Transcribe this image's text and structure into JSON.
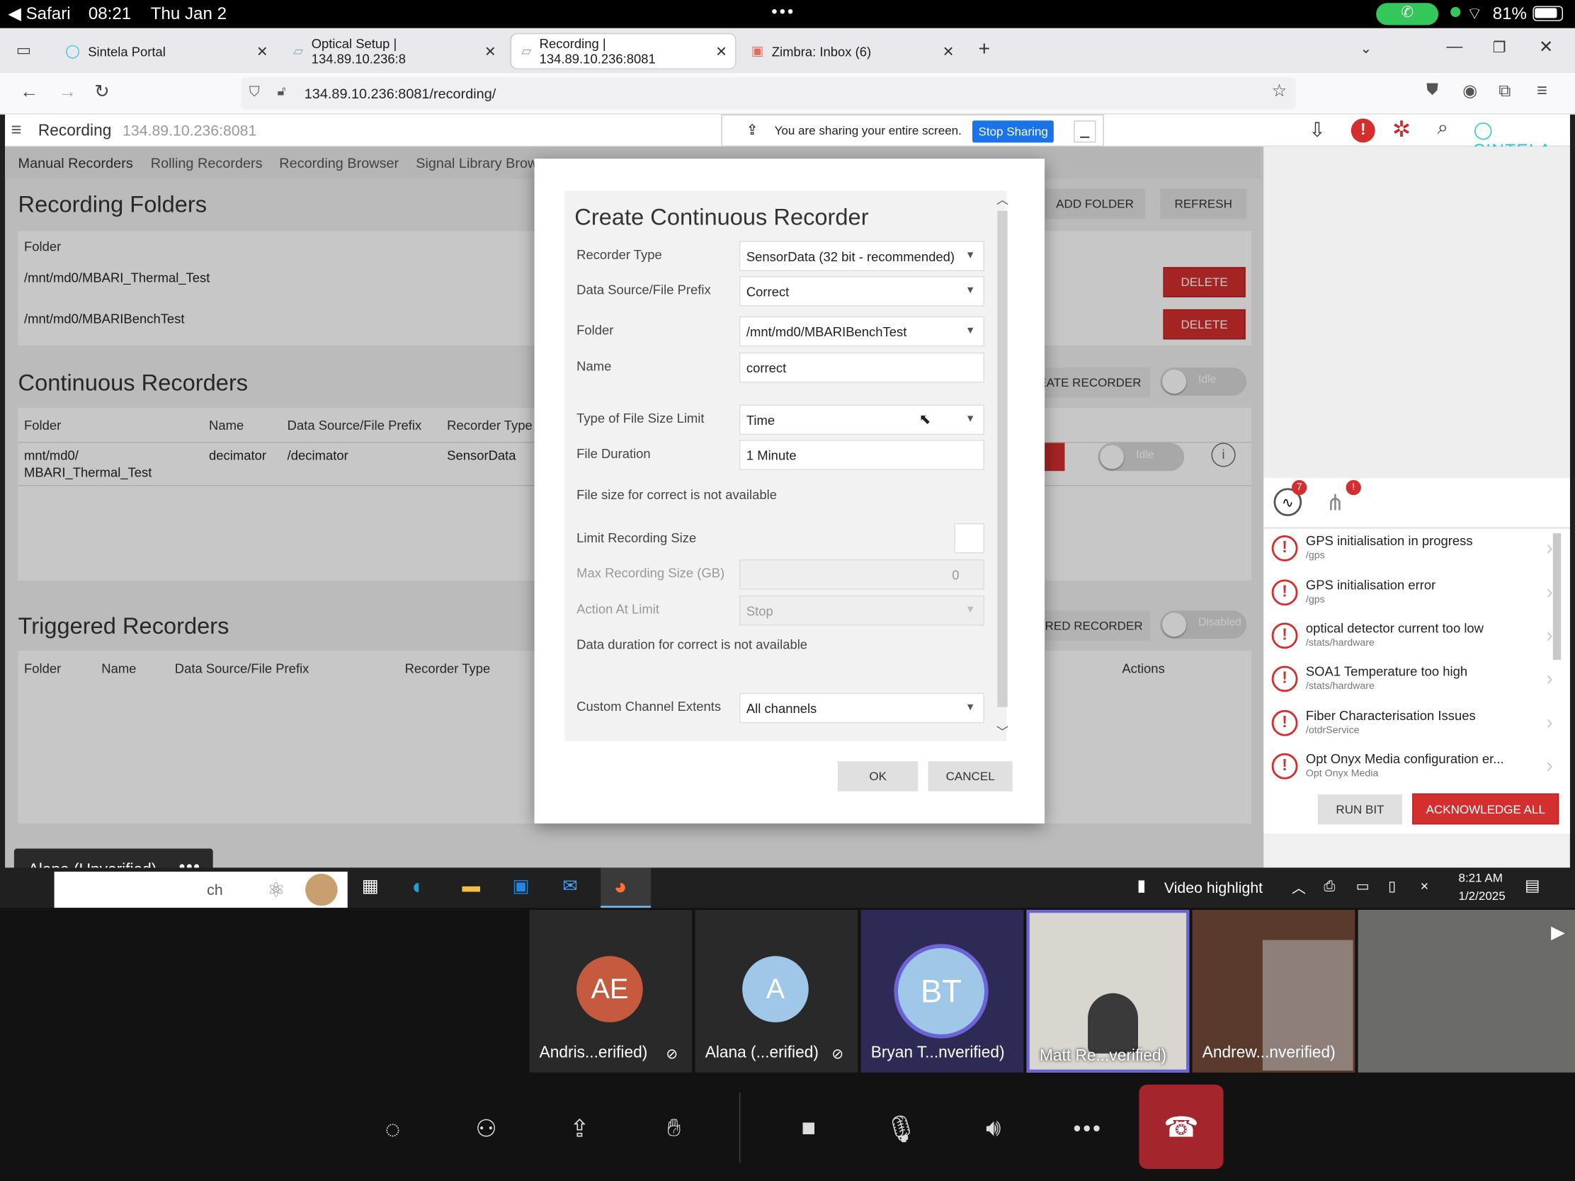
{
  "status": {
    "app": "Safari",
    "time": "08:21",
    "date": "Thu Jan 2",
    "battery": "81%"
  },
  "browser": {
    "tabs": [
      {
        "label": "Sintela Portal"
      },
      {
        "label": "Optical Setup | 134.89.10.236:8"
      },
      {
        "label": "Recording | 134.89.10.236:8081"
      },
      {
        "label": "Zimbra: Inbox (6)"
      }
    ],
    "url": "134.89.10.236:8081/recording/"
  },
  "app": {
    "title": "Recording",
    "host": "134.89.10.236:8081",
    "share_text": "You are sharing your entire screen.",
    "stop_sharing": "Stop Sharing",
    "brand": "SINTELA",
    "nav": [
      "Manual Recorders",
      "Rolling Recorders",
      "Recording Browser",
      "Signal Library Brows"
    ]
  },
  "folders": {
    "title": "Recording Folders",
    "col": "Folder",
    "rows": [
      "/mnt/md0/MBARI_Thermal_Test",
      "/mnt/md0/MBARIBenchTest"
    ],
    "add": "ADD FOLDER",
    "refresh": "REFRESH",
    "delete": "DELETE"
  },
  "continuous": {
    "title": "Continuous Recorders",
    "cols": [
      "Folder",
      "Name",
      "Data Source/File Prefix",
      "Recorder Type"
    ],
    "row": {
      "folder1": "mnt/md0/",
      "folder2": "MBARI_Thermal_Test",
      "name": "decimator",
      "prefix": "/decimator",
      "type": "SensorData"
    },
    "create": "EATE RECORDER",
    "idle": "Idle"
  },
  "triggered": {
    "title": "Triggered Recorders",
    "cols": [
      "Folder",
      "Name",
      "Data Source/File Prefix",
      "Recorder Type"
    ],
    "actions": "Actions",
    "create": "ERED RECORDER",
    "disabled": "Disabled"
  },
  "dialog": {
    "title": "Create Continuous Recorder",
    "recorder_type_label": "Recorder Type",
    "recorder_type": "SensorData (32 bit - recommended)",
    "source_label": "Data Source/File Prefix",
    "source": "Correct",
    "folder_label": "Folder",
    "folder": "/mnt/md0/MBARIBenchTest",
    "name_label": "Name",
    "name": "correct",
    "limit_type_label": "Type of File Size Limit",
    "limit_type": "Time",
    "duration_label": "File Duration",
    "duration": "1 Minute",
    "size_note": "File size for correct is not available",
    "limit_size_label": "Limit Recording Size",
    "max_size_label": "Max Recording Size (GB)",
    "max_size": "0",
    "action_label": "Action At Limit",
    "action": "Stop",
    "duration_note": "Data duration for correct is not available",
    "extents_label": "Custom Channel Extents",
    "extents": "All channels",
    "ok": "OK",
    "cancel": "CANCEL"
  },
  "alerts": {
    "badge1": "7",
    "badge2": "!",
    "items": [
      {
        "t": "GPS initialisation in progress",
        "s": "/gps"
      },
      {
        "t": "GPS initialisation error",
        "s": "/gps"
      },
      {
        "t": "optical detector current too low",
        "s": "/stats/hardware"
      },
      {
        "t": "SOA1 Temperature too high",
        "s": "/stats/hardware"
      },
      {
        "t": "Fiber Characterisation Issues",
        "s": "/otdrService"
      },
      {
        "t": "Opt Onyx Media configuration er...",
        "s": "Opt Onyx Media"
      }
    ],
    "run_bit": "RUN BIT",
    "ack": "ACKNOWLEDGE ALL"
  },
  "taskbar": {
    "presenter": "Alana (Unverified)",
    "search_frag": "ch",
    "video": "Video highlight",
    "clock": "8:21 AM",
    "cdate": "1/2/2025"
  },
  "participants": [
    {
      "initials": "AE",
      "name": "Andris...erified)"
    },
    {
      "initials": "A",
      "name": "Alana (...erified)"
    },
    {
      "initials": "BT",
      "name": "Bryan T...nverified)"
    },
    {
      "initials": "",
      "name": "Matt Re...verified)"
    },
    {
      "initials": "",
      "name": "Andrew...nverified)"
    }
  ],
  "colors": {
    "red": "#d32f2f",
    "blue": "#1976d2",
    "teal": "#26c6da"
  }
}
